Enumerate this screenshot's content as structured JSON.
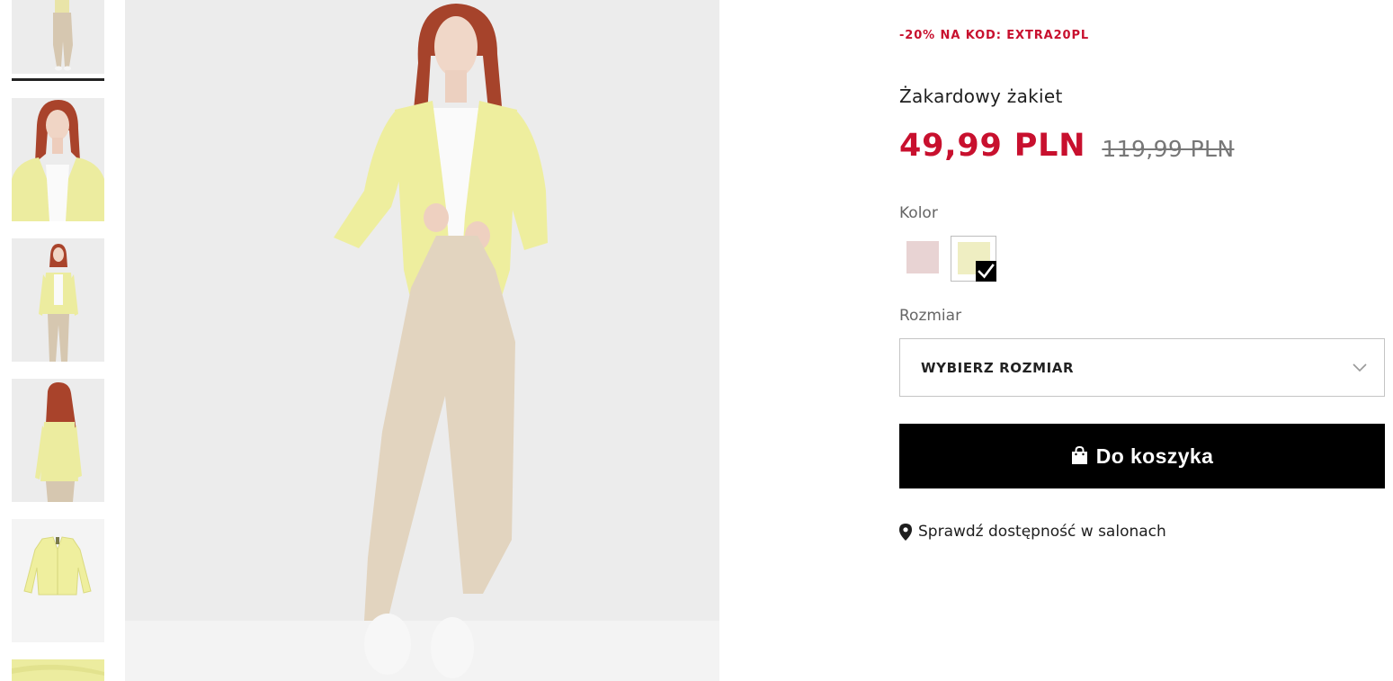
{
  "promo": {
    "text": "-20% NA KOD: EXTRA20PL",
    "color": "#c8102e"
  },
  "product": {
    "title": "Żakardowy żakiet",
    "price_current": "49,99 PLN",
    "price_old": "119,99 PLN"
  },
  "color_section": {
    "label": "Kolor",
    "swatches": [
      {
        "color": "#e8d3d3",
        "selected": false
      },
      {
        "color": "#efeec2",
        "selected": true
      }
    ]
  },
  "size_section": {
    "label": "Rozmiar",
    "select_value": "WYBIERZ ROZMIAR"
  },
  "cart_button": {
    "label": "Do koszyka",
    "icon": "shopping-bag-icon"
  },
  "store_availability": {
    "label": "Sprawdź dostępność w salonach",
    "icon": "map-pin-icon"
  },
  "gallery": {
    "thumbnails": [
      {
        "view": "full-body-front",
        "active": true
      },
      {
        "view": "close-up-front",
        "active": false
      },
      {
        "view": "full-body-front",
        "active": false
      },
      {
        "view": "back",
        "active": false
      },
      {
        "view": "flat-lay",
        "active": false
      },
      {
        "view": "fabric-detail",
        "active": false
      }
    ]
  }
}
